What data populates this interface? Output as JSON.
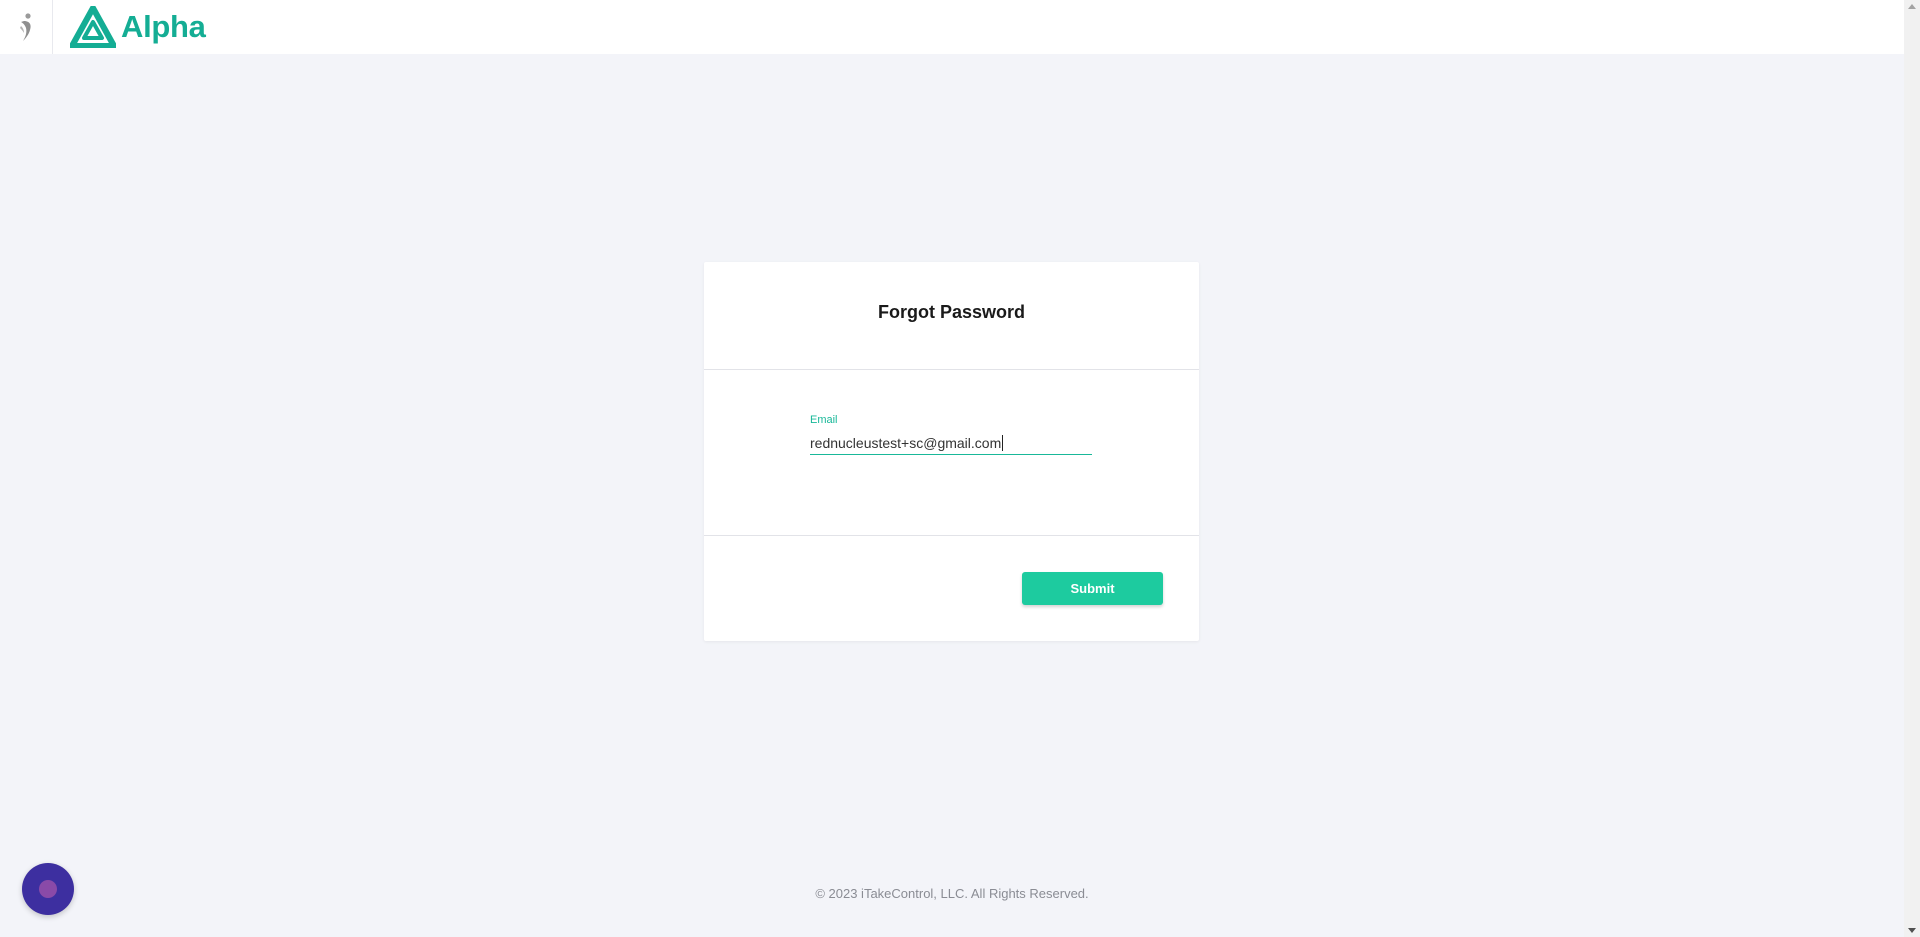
{
  "header": {
    "brand_name": "Alpha",
    "left_icon": "figure-icon",
    "logo_icon": "alpha-logo-icon"
  },
  "colors": {
    "brand": "#14ad94",
    "accent": "#1dcb9f",
    "background": "#f3f4f9",
    "chat": "#3d2fa0"
  },
  "card": {
    "title": "Forgot Password",
    "email_label": "Email",
    "email_value": "rednucleustest+sc@gmail.com",
    "submit_label": "Submit"
  },
  "footer": {
    "copyright": "© 2023 iTakeControl, LLC. All Rights Reserved."
  },
  "chat": {
    "icon": "chat-icon"
  }
}
